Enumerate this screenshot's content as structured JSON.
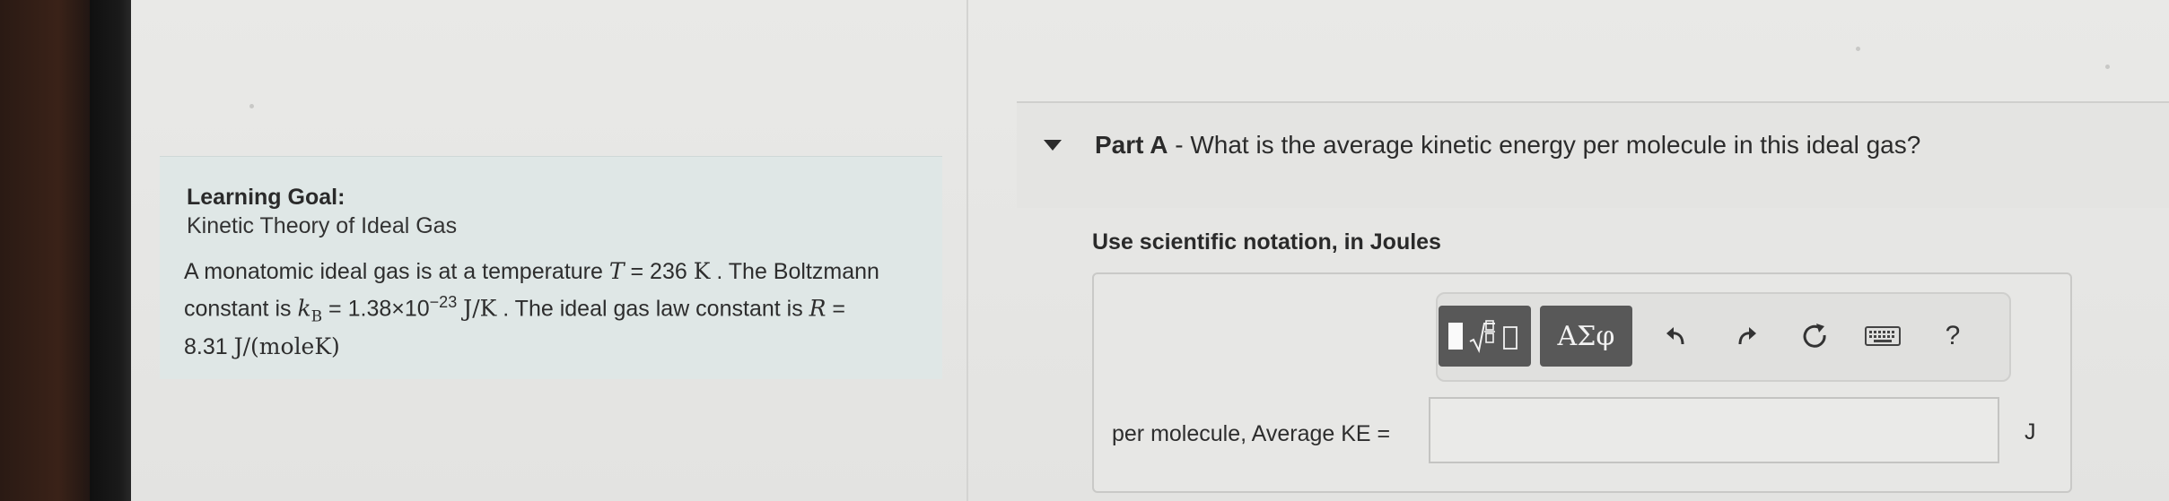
{
  "learning_goal": {
    "title": "Learning Goal:",
    "subtitle": "Kinetic Theory of Ideal Gas",
    "t1": "A monatomic ideal gas is at a temperature ",
    "T_sym": "T",
    "t2": " = 236 ",
    "K_unit": "K",
    "t3": " . The Boltzmann constant is ",
    "kB_sym": "k",
    "kB_sub": "B",
    "t4": " = 1.38×10",
    "exp": "−23",
    "t5": " ",
    "JK_unit": "J/K",
    "t6": " . The ideal gas law constant is ",
    "R_sym": "R",
    "t7": " = 8.31 ",
    "R_unit": "J/(moleK)"
  },
  "part_a": {
    "label": "Part A",
    "question": " - What is the average kinetic energy per molecule in this ideal gas?"
  },
  "instruction": "Use scientific notation, in Joules",
  "toolbar": {
    "greek_label": "ΑΣφ",
    "help_label": "?"
  },
  "answer": {
    "label": "per molecule, Average KE =",
    "value": "",
    "unit": "J"
  },
  "colors": {
    "button_dark": "#585858",
    "panel_teal": "#dfe7e6"
  }
}
